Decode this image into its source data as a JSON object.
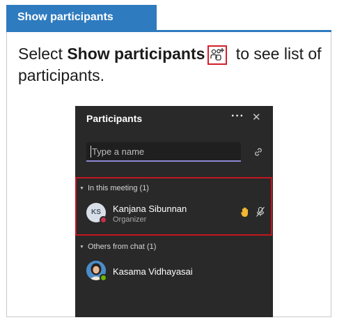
{
  "slide": {
    "tab_label": "Show participants",
    "instruction_pre": "Select ",
    "instruction_bold": "Show participants",
    "instruction_post": " to see list of participants."
  },
  "panel": {
    "title": "Participants",
    "more_label": "···",
    "close_label": "✕",
    "search_placeholder": "Type a name",
    "sections": [
      {
        "header": "In this meeting (1)",
        "participants": [
          {
            "initials": "KS",
            "name": "Kanjana Sibunnan",
            "role": "Organizer",
            "presence": "busy"
          }
        ]
      },
      {
        "header": "Others from chat (1)",
        "participants": [
          {
            "name": "Kasama Vidhayasai",
            "presence": "available"
          }
        ]
      }
    ]
  },
  "colors": {
    "accent_blue": "#2f7bbf",
    "highlight_red": "#c3161f",
    "panel_bg": "#292929",
    "raise_hand": "#f2b632",
    "busy": "#c4314b",
    "available": "#6bb700"
  },
  "icons": {
    "show_participants": "people-add-icon",
    "raise_hand": "raise-hand-icon",
    "mic_muted": "mic-off-icon",
    "share_invite": "link-icon"
  }
}
